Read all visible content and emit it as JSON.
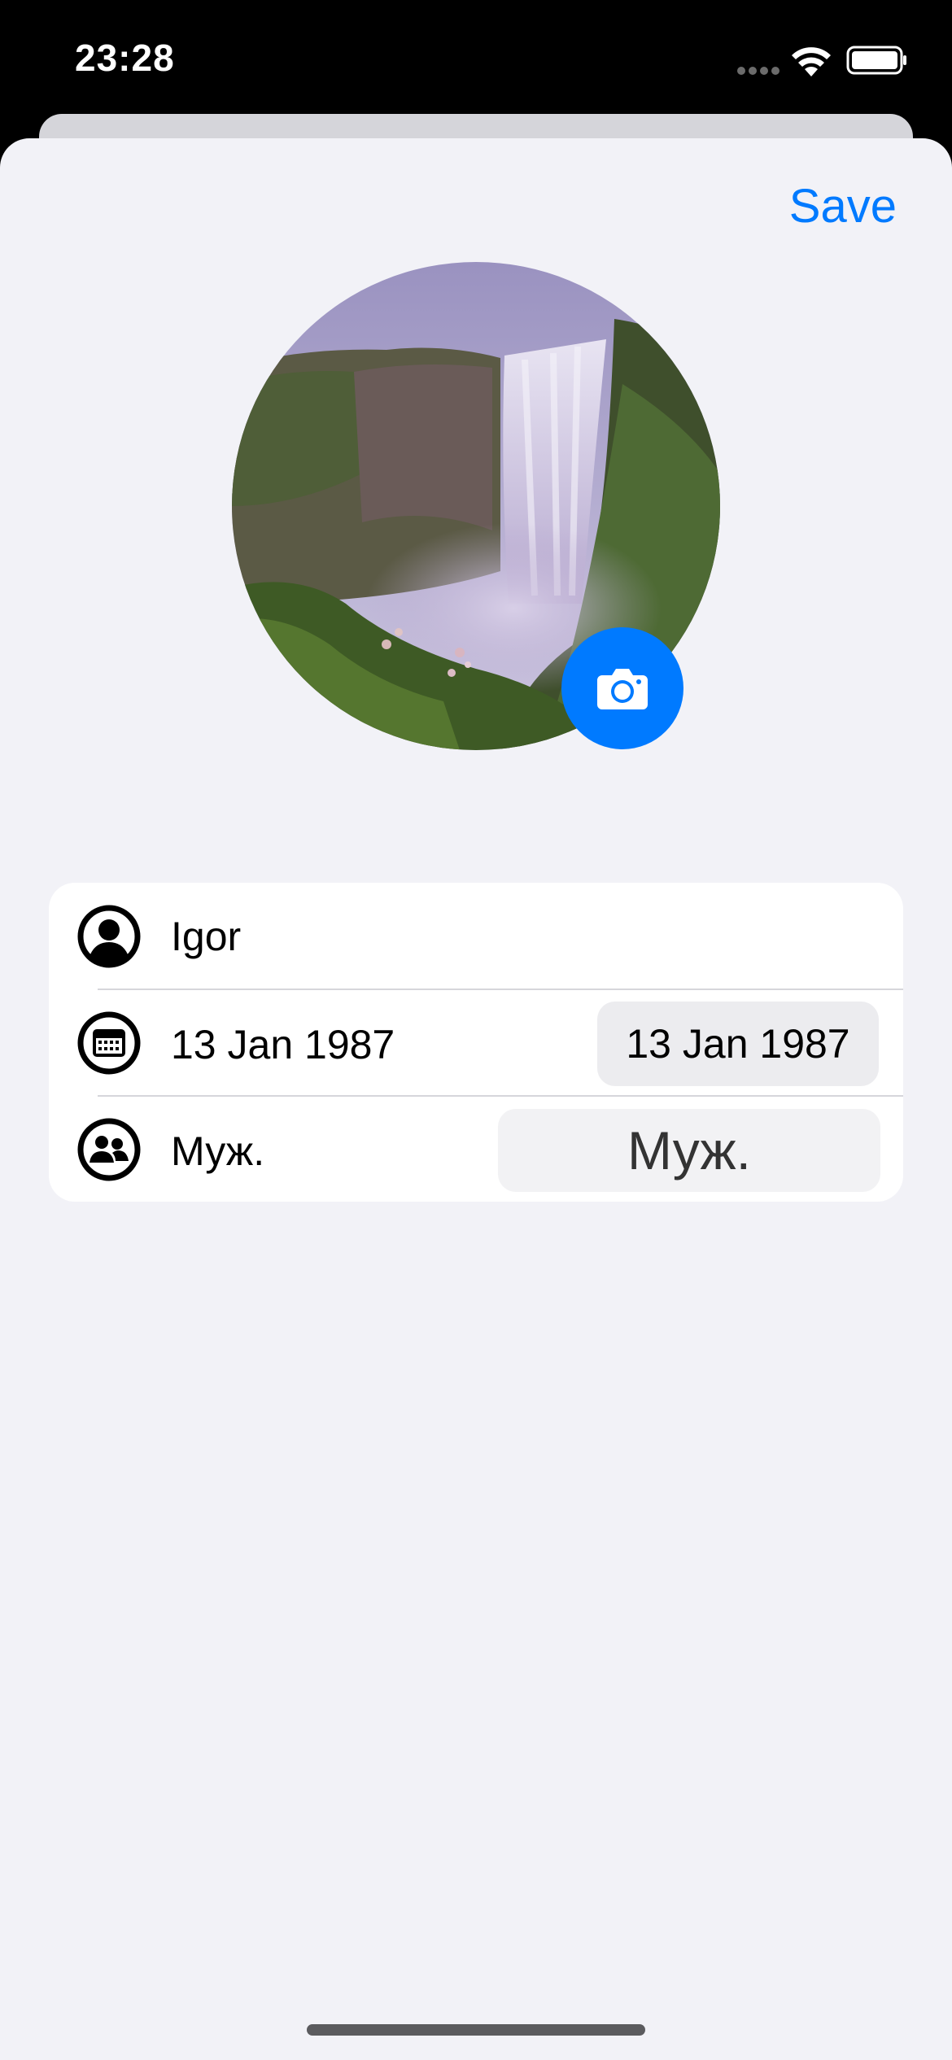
{
  "status_bar": {
    "time": "23:28",
    "icons": [
      "signal-icon",
      "wifi-icon",
      "battery-icon"
    ]
  },
  "header": {
    "save_label": "Save",
    "accent_color": "#007aff"
  },
  "avatar": {
    "photo": "waterfall-photo",
    "camera_icon": "camera-icon"
  },
  "form": {
    "name": {
      "icon": "person-circle-icon",
      "value": "Igor"
    },
    "birthday": {
      "icon": "calendar-icon",
      "label": "13 Jan 1987",
      "picker_value": "13 Jan 1987"
    },
    "gender": {
      "icon": "people-circle-icon",
      "label": "Муж.",
      "picker_value": "Муж."
    }
  }
}
